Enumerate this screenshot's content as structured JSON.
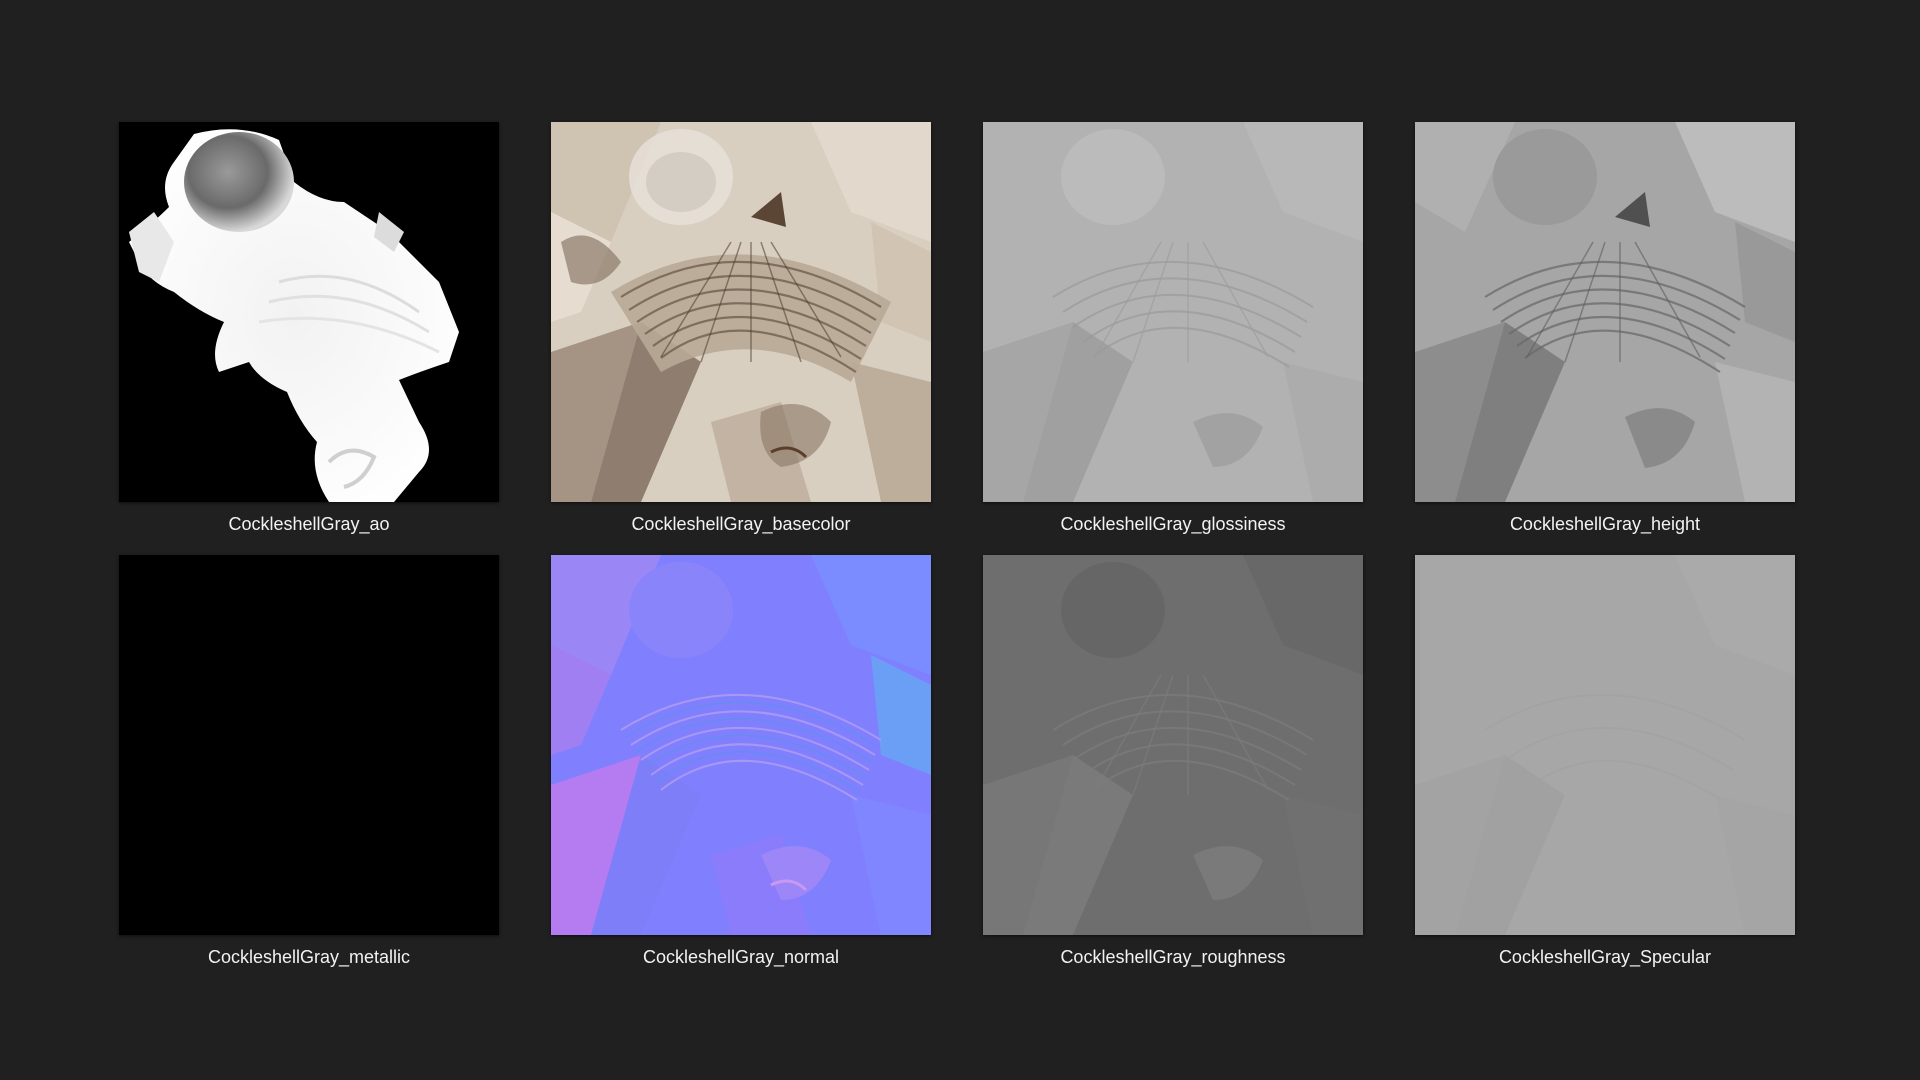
{
  "files": [
    {
      "name": "CockleshellGray_ao",
      "map": "ao"
    },
    {
      "name": "CockleshellGray_basecolor",
      "map": "basecolor"
    },
    {
      "name": "CockleshellGray_glossiness",
      "map": "glossiness"
    },
    {
      "name": "CockleshellGray_height",
      "map": "height"
    },
    {
      "name": "CockleshellGray_metallic",
      "map": "metallic"
    },
    {
      "name": "CockleshellGray_normal",
      "map": "normal"
    },
    {
      "name": "CockleshellGray_roughness",
      "map": "roughness"
    },
    {
      "name": "CockleshellGray_Specular",
      "map": "specular"
    }
  ],
  "colors": {
    "background": "#202020",
    "caption": "#f2f2f2",
    "basecolor_bg": "#d9cfc0",
    "glossiness_bg": "#b2b2b2",
    "height_bg": "#a6a6a6",
    "metallic_bg": "#000000",
    "normal_bg": "#8080ff",
    "roughness_bg": "#6e6e6e",
    "specular_bg": "#a7a7a7"
  }
}
